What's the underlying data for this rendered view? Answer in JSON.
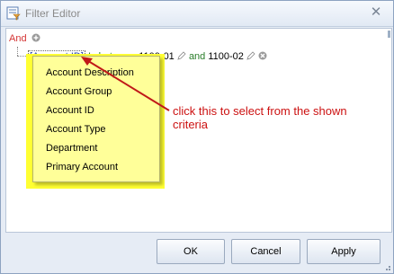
{
  "window": {
    "title": "Filter Editor"
  },
  "root_group": {
    "operator_label": "And"
  },
  "condition": {
    "field": "[Account ID]",
    "operator": "Is between",
    "value_from": "1100-01",
    "conjunction": "and",
    "value_to": "1100-02"
  },
  "dropdown": {
    "items": [
      "Account Description",
      "Account Group",
      "Account ID",
      "Account Type",
      "Department",
      "Primary Account"
    ]
  },
  "annotation": {
    "line1": "click this to select from the shown",
    "line2": "criteria"
  },
  "buttons": {
    "ok": "OK",
    "cancel": "Cancel",
    "apply": "Apply"
  },
  "colors": {
    "annotation": "#cc1111",
    "highlight": "#ffff33",
    "dropdown_bg": "#ffff99",
    "root_operator": "#d43333",
    "field_text": "#1f3fae",
    "operator_text": "#2a7d2a"
  },
  "icons": [
    "filter-editor-icon",
    "close-icon",
    "add-condition-icon",
    "edit-pencil-icon",
    "remove-condition-icon",
    "resize-grip-icon"
  ]
}
